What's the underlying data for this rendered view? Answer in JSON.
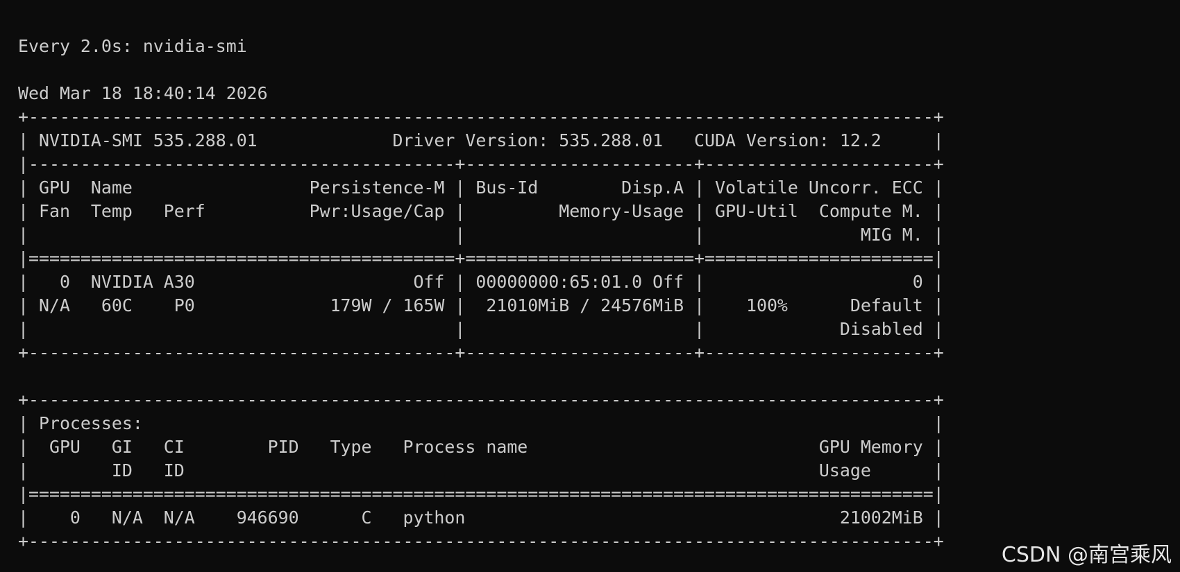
{
  "watch": {
    "header": "Every 2.0s: nvidia-smi",
    "timestamp": "Wed Mar 18 18:40:14 2026"
  },
  "lines": [
    "+---------------------------------------------------------------------------------------+",
    "| NVIDIA-SMI 535.288.01             Driver Version: 535.288.01   CUDA Version: 12.2     |",
    "|-----------------------------------------+----------------------+----------------------+",
    "| GPU  Name                 Persistence-M | Bus-Id        Disp.A | Volatile Uncorr. ECC |",
    "| Fan  Temp   Perf          Pwr:Usage/Cap |         Memory-Usage | GPU-Util  Compute M. |",
    "|                                         |                      |               MIG M. |",
    "|=========================================+======================+======================|",
    "|   0  NVIDIA A30                     Off | 00000000:65:01.0 Off |                    0 |",
    "| N/A   60C    P0             179W / 165W |  21010MiB / 24576MiB |    100%      Default |",
    "|                                         |                      |             Disabled |",
    "+-----------------------------------------+----------------------+----------------------+",
    "",
    "+---------------------------------------------------------------------------------------+",
    "| Processes:                                                                            |",
    "|  GPU   GI   CI        PID   Type   Process name                            GPU Memory |",
    "|        ID   ID                                                             Usage      |",
    "|=======================================================================================|",
    "|    0   N/A  N/A    946690      C   python                                    21002MiB |",
    "+---------------------------------------------------------------------------------------+"
  ],
  "watermark": "CSDN @南宫乘风"
}
